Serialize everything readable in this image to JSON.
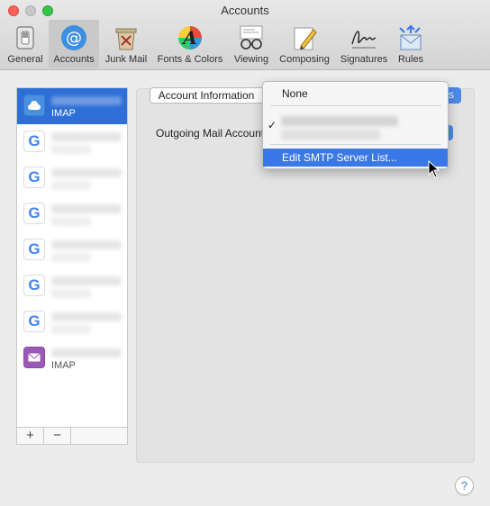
{
  "window": {
    "title": "Accounts"
  },
  "toolbar": {
    "items": [
      {
        "label": "General",
        "icon": "switch-icon"
      },
      {
        "label": "Accounts",
        "icon": "at-sign-icon",
        "active": true
      },
      {
        "label": "Junk Mail",
        "icon": "trash-bin-icon"
      },
      {
        "label": "Fonts & Colors",
        "icon": "font-palette-icon"
      },
      {
        "label": "Viewing",
        "icon": "glasses-icon"
      },
      {
        "label": "Composing",
        "icon": "pencil-paper-icon"
      },
      {
        "label": "Signatures",
        "icon": "signature-icon"
      },
      {
        "label": "Rules",
        "icon": "envelope-arrows-icon"
      }
    ]
  },
  "sidebar": {
    "accounts": [
      {
        "type": "IMAP",
        "icon": "icloud-icon",
        "selected": true
      },
      {
        "type": "",
        "icon": "google-icon"
      },
      {
        "type": "",
        "icon": "google-icon"
      },
      {
        "type": "",
        "icon": "google-icon"
      },
      {
        "type": "",
        "icon": "google-icon"
      },
      {
        "type": "",
        "icon": "google-icon"
      },
      {
        "type": "",
        "icon": "google-icon"
      },
      {
        "type": "IMAP",
        "icon": "mail-icon"
      }
    ],
    "footer": {
      "add": "+",
      "remove": "−"
    }
  },
  "main": {
    "tab_account_info": "Account Information",
    "tab_right_partial": "s",
    "outgoing_label": "Outgoing Mail Account"
  },
  "menu": {
    "none_label": "None",
    "checkmark": "✓",
    "edit_smtp_label": "Edit SMTP Server List..."
  },
  "help": {
    "label": "?"
  },
  "colors": {
    "accent": "#3b78e7",
    "selection": "#2d6fd6",
    "google_blue": "#4285f4"
  }
}
